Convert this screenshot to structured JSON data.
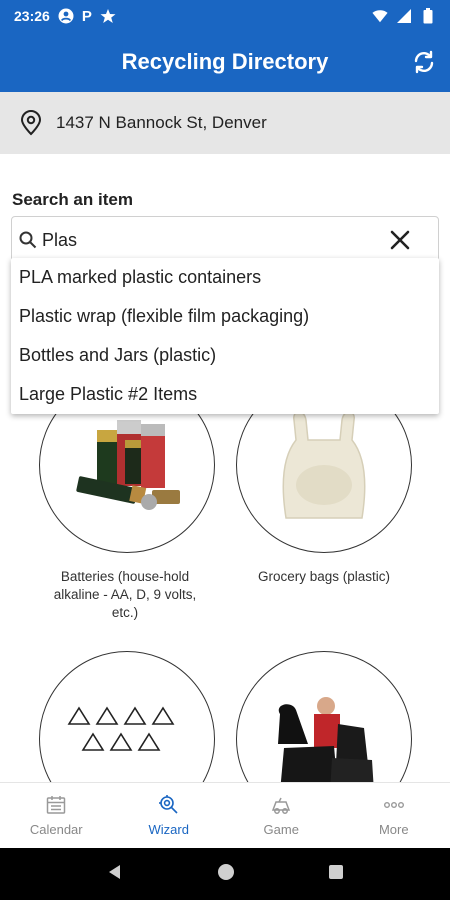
{
  "status_bar": {
    "time": "23:26",
    "p_label": "P"
  },
  "app_bar": {
    "title": "Recycling Directory",
    "refresh_icon": "refresh-icon"
  },
  "address": {
    "text": "1437 N Bannock St, Denver",
    "icon": "location-pin-icon"
  },
  "search": {
    "label": "Search an item",
    "value": "Plas",
    "suggestions": [
      "PLA marked plastic containers",
      "Plastic wrap (flexible film packaging)",
      "Bottles and Jars (plastic)",
      "Large Plastic #2 Items"
    ]
  },
  "grid": {
    "items": [
      {
        "label": "Batteries (house-hold alkaline - AA, D, 9 volts, etc.)"
      },
      {
        "label": "Grocery bags (plastic)"
      },
      {
        "label": ""
      },
      {
        "label": ""
      }
    ]
  },
  "bottom_nav": {
    "items": [
      {
        "label": "Calendar",
        "icon": "calendar-icon"
      },
      {
        "label": "Wizard",
        "icon": "wizard-icon"
      },
      {
        "label": "Game",
        "icon": "game-icon"
      },
      {
        "label": "More",
        "icon": "more-icon"
      }
    ]
  },
  "colors": {
    "primary": "#1a66c2",
    "nav_inactive": "#888888"
  }
}
